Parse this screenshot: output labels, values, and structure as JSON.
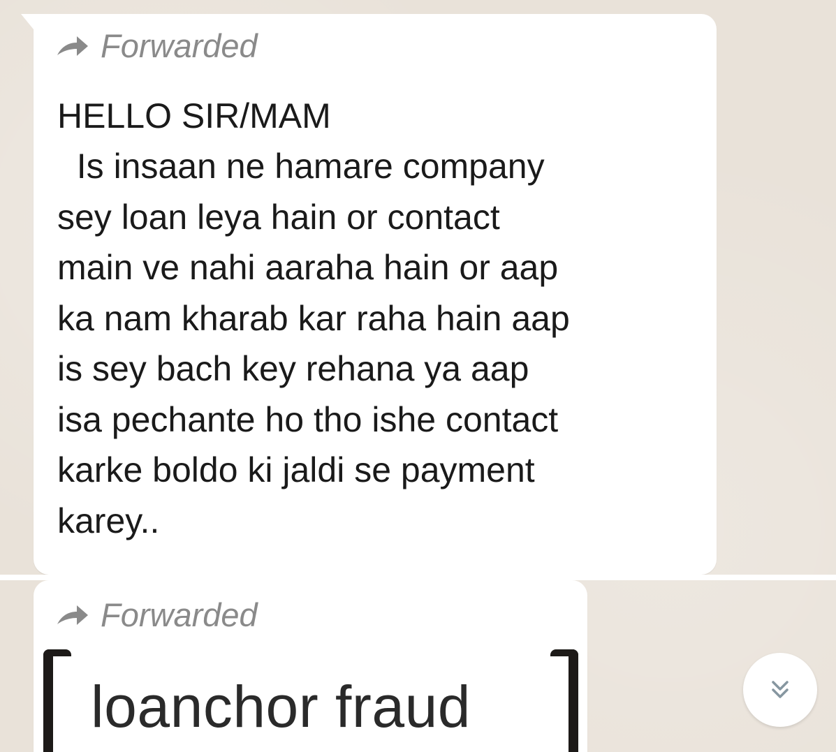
{
  "messages": [
    {
      "forwarded_label": "Forwarded",
      "greeting": "HELLO SIR/MAM",
      "body_lines": [
        "  Is insaan ne hamare company",
        "sey loan leya hain or contact",
        "main ve nahi aaraha hain or aap",
        "ka nam kharab kar raha hain aap",
        "is sey bach key rehana ya aap",
        "isa pechante ho tho ishe contact",
        "karke boldo ki jaldi se payment",
        "karey.."
      ]
    },
    {
      "forwarded_label": "Forwarded",
      "highlight_text": "loanchor fraud"
    }
  ],
  "colors": {
    "chat_background": "#e9e2d9",
    "bubble": "#ffffff",
    "message_text": "#1a1a1a",
    "forwarded_text": "#8a8a8a",
    "scroll_icon": "#8696a0"
  },
  "icons": {
    "forward": "forward-arrow-icon",
    "scroll": "double-chevron-down-icon"
  }
}
